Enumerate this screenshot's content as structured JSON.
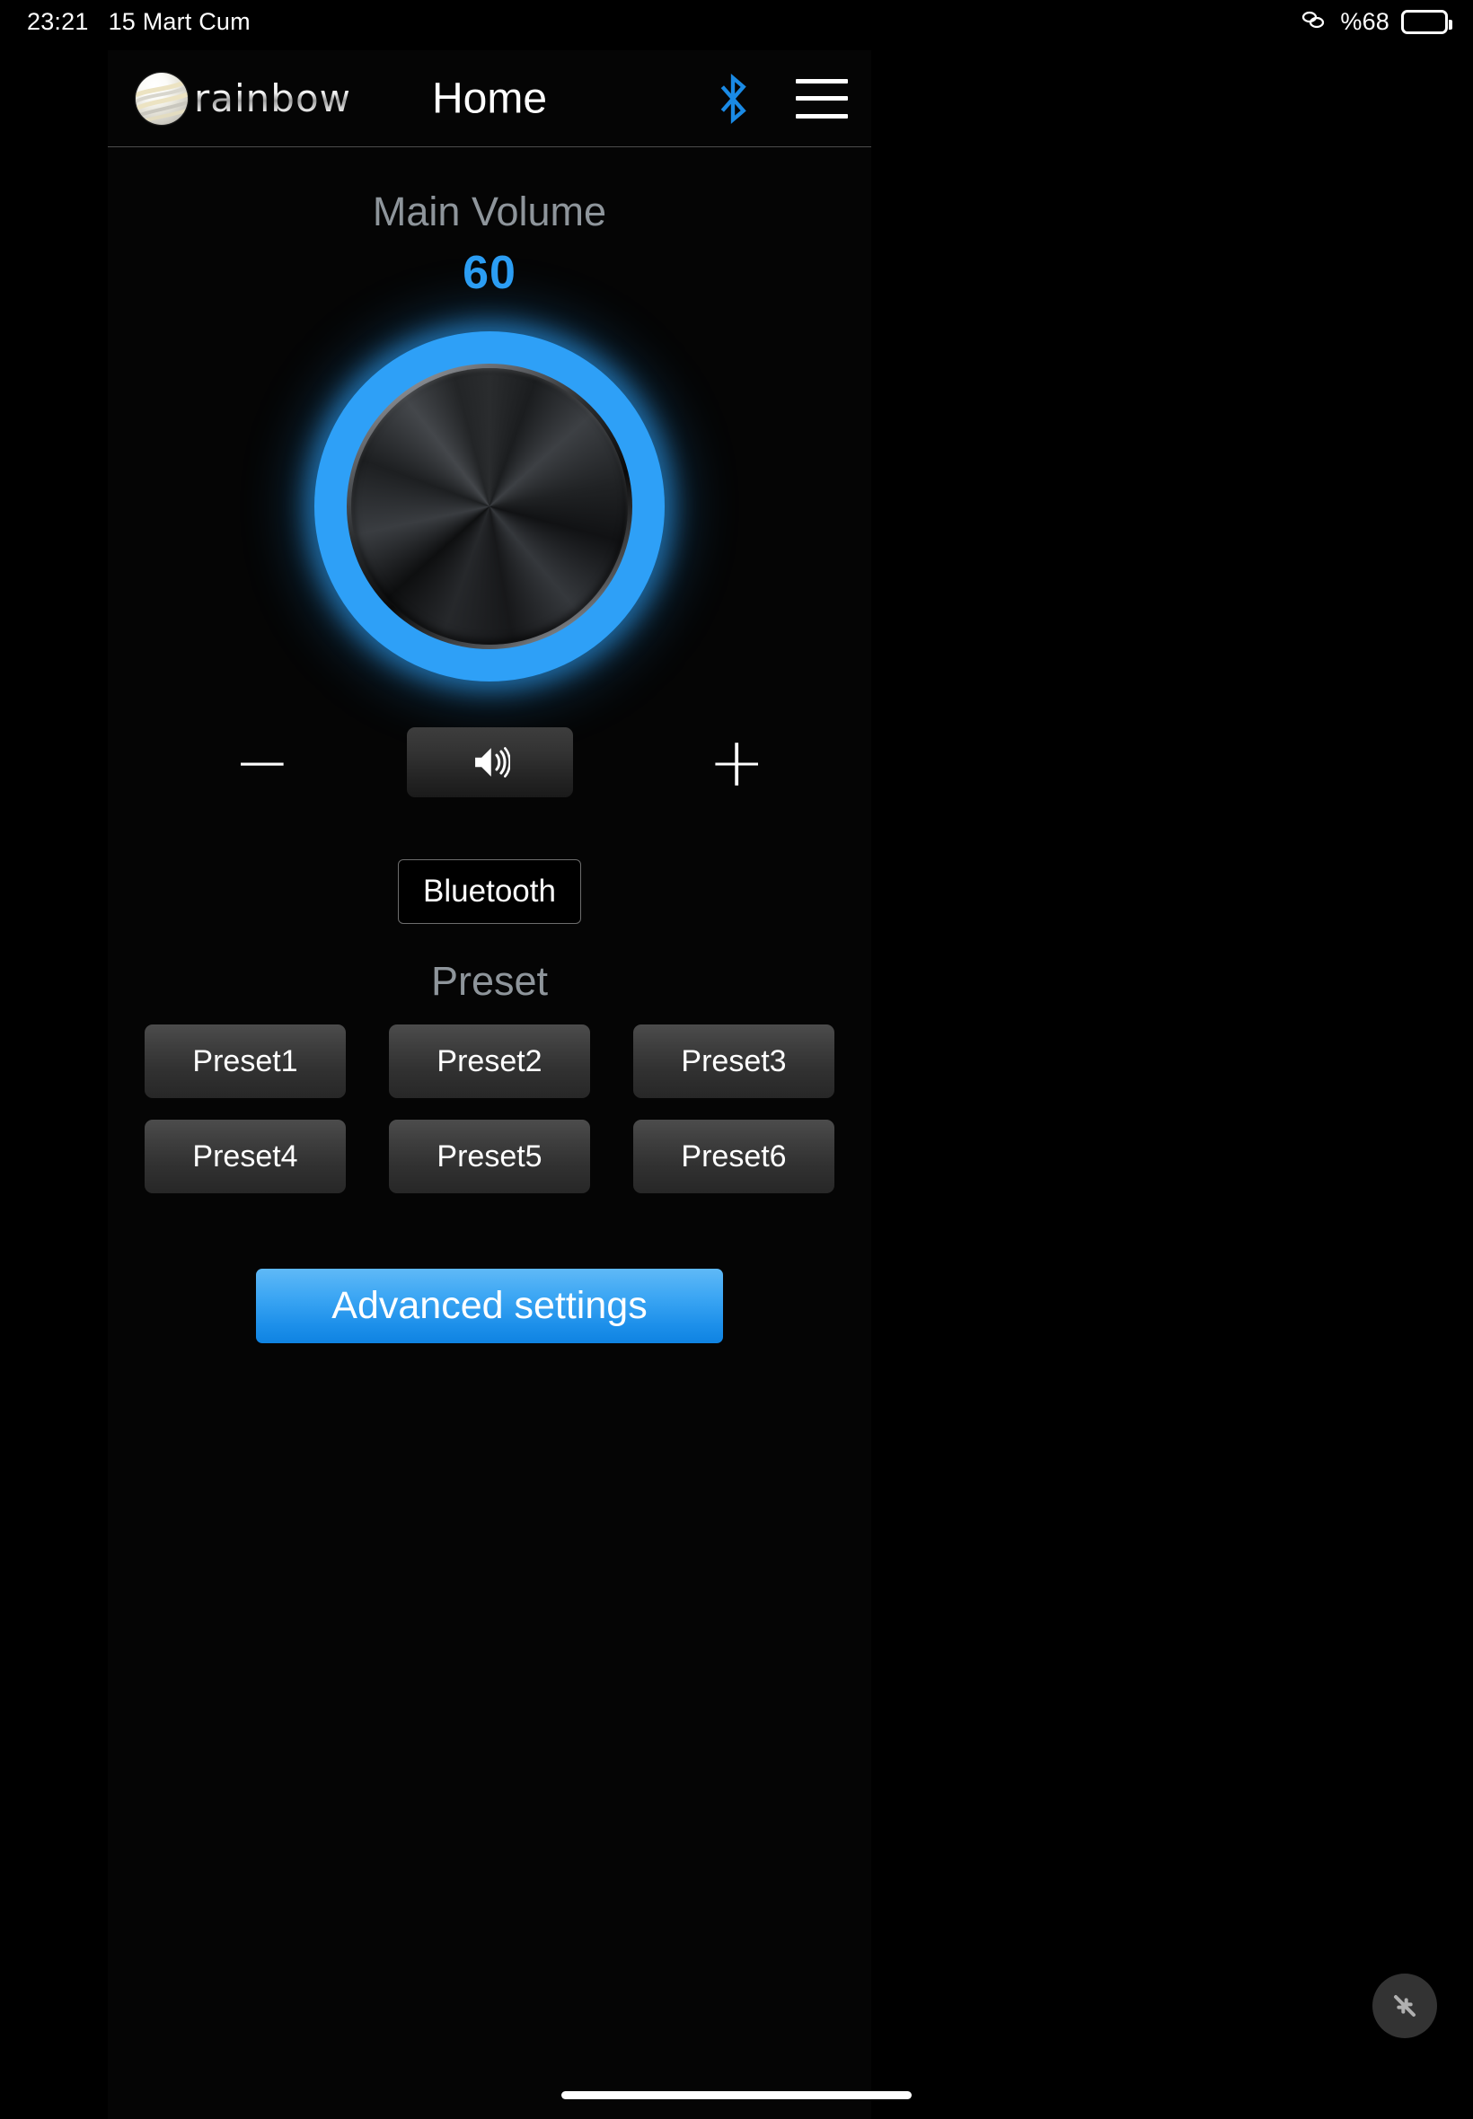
{
  "status_bar": {
    "time": "23:21",
    "date": "15 Mart Cum",
    "link_icon": "link-icon",
    "battery_text": "%68",
    "battery_percent": 68
  },
  "header": {
    "brand": "rainbow",
    "logo_icon": "rainbow-sphere-logo",
    "title": "Home",
    "bluetooth_icon": "bluetooth-icon",
    "menu_icon": "hamburger-menu-icon"
  },
  "volume": {
    "label": "Main Volume",
    "value": "60",
    "knob_icon": "volume-knob",
    "minus_label": "−",
    "plus_label": "+",
    "mute_icon": "speaker-icon"
  },
  "bluetooth": {
    "button_label": "Bluetooth"
  },
  "presets": {
    "title": "Preset",
    "items": [
      {
        "label": "Preset1"
      },
      {
        "label": "Preset2"
      },
      {
        "label": "Preset3"
      },
      {
        "label": "Preset4"
      },
      {
        "label": "Preset5"
      },
      {
        "label": "Preset6"
      }
    ]
  },
  "advanced": {
    "button_label": "Advanced settings"
  },
  "floating": {
    "shrink_icon": "shrink-arrows-icon"
  },
  "colors": {
    "accent_blue": "#2c9ef4",
    "knob_ring": "#2ea0f7",
    "muted_text": "#8e959b",
    "adv_button_top": "#5fb9f7",
    "adv_button_bottom": "#0f83e2",
    "background": "#000000"
  }
}
